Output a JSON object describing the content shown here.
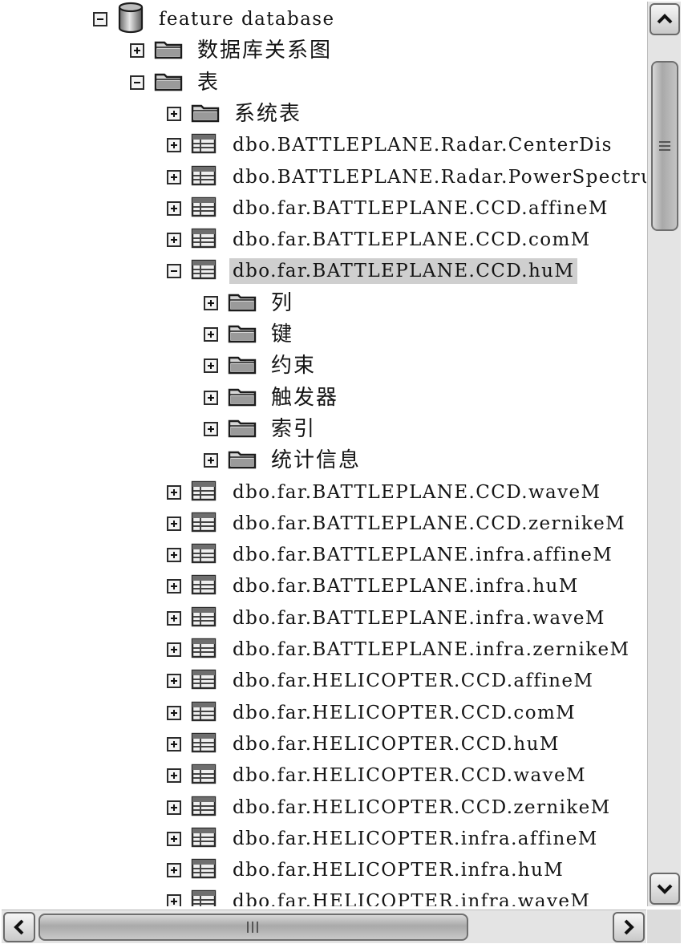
{
  "tree": {
    "root": {
      "label": "feature database",
      "icon": "database-icon",
      "expanded": true
    },
    "nodes": [
      {
        "label": "数据库关系图",
        "icon": "folder-icon",
        "expanded": false,
        "level": 1
      },
      {
        "label": "表",
        "icon": "folder-icon",
        "expanded": true,
        "level": 1
      },
      {
        "label": "系统表",
        "icon": "folder-icon",
        "expanded": false,
        "level": 2
      },
      {
        "label": "dbo.BATTLEPLANE.Radar.CenterDis",
        "icon": "table-icon",
        "expanded": false,
        "level": 2
      },
      {
        "label": "dbo.BATTLEPLANE.Radar.PowerSpectrum",
        "icon": "table-icon",
        "expanded": false,
        "level": 2
      },
      {
        "label": "dbo.far.BATTLEPLANE.CCD.affineM",
        "icon": "table-icon",
        "expanded": false,
        "level": 2
      },
      {
        "label": "dbo.far.BATTLEPLANE.CCD.comM",
        "icon": "table-icon",
        "expanded": false,
        "level": 2
      },
      {
        "label": "dbo.far.BATTLEPLANE.CCD.huM",
        "icon": "table-icon",
        "expanded": true,
        "selected": true,
        "level": 2
      },
      {
        "label": "列",
        "icon": "folder-icon",
        "expanded": false,
        "level": 3
      },
      {
        "label": "键",
        "icon": "folder-icon",
        "expanded": false,
        "level": 3
      },
      {
        "label": "约束",
        "icon": "folder-icon",
        "expanded": false,
        "level": 3
      },
      {
        "label": "触发器",
        "icon": "folder-icon",
        "expanded": false,
        "level": 3
      },
      {
        "label": "索引",
        "icon": "folder-icon",
        "expanded": false,
        "level": 3
      },
      {
        "label": "统计信息",
        "icon": "folder-icon",
        "expanded": false,
        "level": 3
      },
      {
        "label": "dbo.far.BATTLEPLANE.CCD.waveM",
        "icon": "table-icon",
        "expanded": false,
        "level": 2
      },
      {
        "label": "dbo.far.BATTLEPLANE.CCD.zernikeM",
        "icon": "table-icon",
        "expanded": false,
        "level": 2
      },
      {
        "label": "dbo.far.BATTLEPLANE.infra.affineM",
        "icon": "table-icon",
        "expanded": false,
        "level": 2
      },
      {
        "label": "dbo.far.BATTLEPLANE.infra.huM",
        "icon": "table-icon",
        "expanded": false,
        "level": 2
      },
      {
        "label": "dbo.far.BATTLEPLANE.infra.waveM",
        "icon": "table-icon",
        "expanded": false,
        "level": 2
      },
      {
        "label": "dbo.far.BATTLEPLANE.infra.zernikeM",
        "icon": "table-icon",
        "expanded": false,
        "level": 2
      },
      {
        "label": "dbo.far.HELICOPTER.CCD.affineM",
        "icon": "table-icon",
        "expanded": false,
        "level": 2
      },
      {
        "label": "dbo.far.HELICOPTER.CCD.comM",
        "icon": "table-icon",
        "expanded": false,
        "level": 2
      },
      {
        "label": "dbo.far.HELICOPTER.CCD.huM",
        "icon": "table-icon",
        "expanded": false,
        "level": 2
      },
      {
        "label": "dbo.far.HELICOPTER.CCD.waveM",
        "icon": "table-icon",
        "expanded": false,
        "level": 2
      },
      {
        "label": "dbo.far.HELICOPTER.CCD.zernikeM",
        "icon": "table-icon",
        "expanded": false,
        "level": 2
      },
      {
        "label": "dbo.far.HELICOPTER.infra.affineM",
        "icon": "table-icon",
        "expanded": false,
        "level": 2
      },
      {
        "label": "dbo.far.HELICOPTER.infra.huM",
        "icon": "table-icon",
        "expanded": false,
        "level": 2
      },
      {
        "label": "dbo.far.HELICOPTER.infra.waveM",
        "icon": "table-icon",
        "expanded": false,
        "level": 2
      }
    ]
  },
  "scrollbars": {
    "vertical": {
      "up_icon": "chevron-up-icon",
      "down_icon": "chevron-down-icon"
    },
    "horizontal": {
      "left_icon": "chevron-left-icon",
      "right_icon": "chevron-right-icon"
    }
  },
  "colors": {
    "selection": "#cfcfcf",
    "text": "#141414",
    "background": "#ffffff"
  }
}
